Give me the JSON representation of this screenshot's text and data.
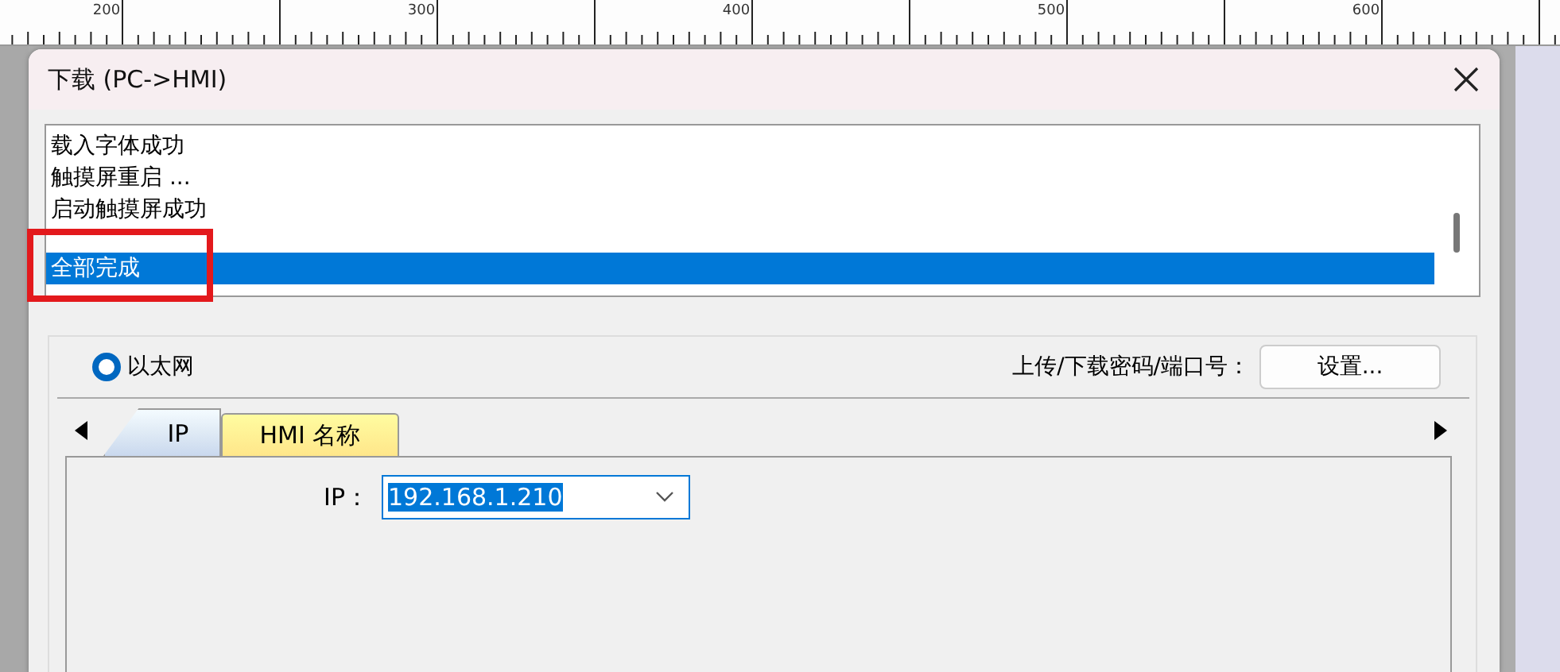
{
  "ruler": {
    "labels": [
      "200",
      "300",
      "400",
      "500",
      "600"
    ]
  },
  "window": {
    "title": "下载 (PC->HMI)"
  },
  "log": {
    "lines": [
      {
        "kind": "text",
        "text": "载入字体成功",
        "selected": false
      },
      {
        "kind": "text",
        "text": "触摸屏重启 ...",
        "selected": false
      },
      {
        "kind": "text",
        "text": "启动触摸屏成功",
        "selected": false
      },
      {
        "kind": "blank"
      },
      {
        "kind": "text",
        "text": "全部完成",
        "selected": true
      }
    ]
  },
  "connection": {
    "radio": {
      "label": "以太网",
      "selected": true
    },
    "password_label": "上传/下载密码/端口号：",
    "settings_button": "设置..."
  },
  "tabs": [
    {
      "label": "IP",
      "selected": true,
      "kind": "plain"
    },
    {
      "label": "HMI 名称",
      "selected": false,
      "kind": "yellow"
    }
  ],
  "ip_field": {
    "label": "IP：",
    "value": "192.168.1.210"
  }
}
